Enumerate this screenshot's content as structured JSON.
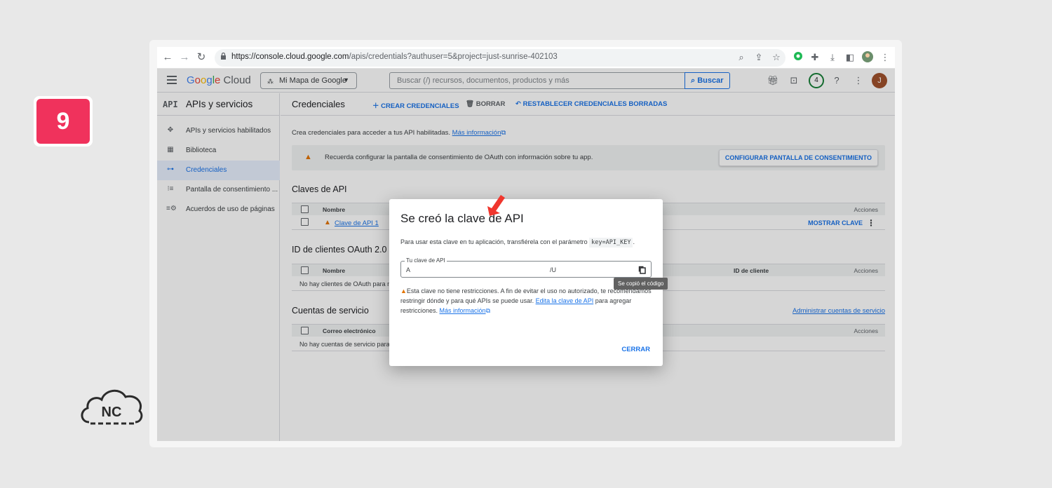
{
  "step": {
    "number": "9"
  },
  "brand": {
    "logo_text": "NC"
  },
  "browser": {
    "url_host": "https://console.cloud.google.com",
    "url_path": "/apis/credentials?authuser=5&project=just-sunrise-402103"
  },
  "header": {
    "logo": {
      "g1": "G",
      "g2": "o",
      "g3": "o",
      "g4": "g",
      "g5": "l",
      "g6": "e",
      "cloud": " Cloud"
    },
    "project": "Mi Mapa de Google",
    "search_placeholder": "Buscar (/) recursos, documentos, productos y más",
    "search_button": "Buscar",
    "notifications": "4",
    "avatar": "J"
  },
  "sidebar": {
    "badge": "API",
    "title": "APIs y servicios",
    "items": [
      {
        "icon": "✥",
        "label": "APIs y servicios habilitados"
      },
      {
        "icon": "▦",
        "label": "Biblioteca"
      },
      {
        "icon": "⊶",
        "label": "Credenciales"
      },
      {
        "icon": "⁝≡",
        "label": "Pantalla de consentimiento ..."
      },
      {
        "icon": "≡⚙",
        "label": "Acuerdos de uso de páginas"
      }
    ]
  },
  "toolbar": {
    "title": "Credenciales",
    "create": "CREAR CREDENCIALES",
    "delete": "BORRAR",
    "restore": "RESTABLECER CREDENCIALES BORRADAS"
  },
  "main": {
    "description": "Crea credenciales para acceder a tus API habilitadas.",
    "more_info": "Más información",
    "oauth_warning": "Recuerda configurar la pantalla de consentimiento de OAuth con información sobre tu app.",
    "configure_button": "CONFIGURAR PANTALLA DE CONSENTIMIENTO",
    "api_keys": {
      "title": "Claves de API",
      "col_name": "Nombre",
      "col_actions": "Acciones",
      "row_name": "Clave de API 1",
      "show_key": "MOSTRAR CLAVE"
    },
    "oauth_clients": {
      "title": "ID de clientes OAuth 2.0",
      "col_name": "Nombre",
      "col_client_id": "ID de cliente",
      "col_actions": "Acciones",
      "empty": "No hay clientes de OAuth para m"
    },
    "service_accounts": {
      "title": "Cuentas de servicio",
      "manage": "Administrar cuentas de servicio",
      "col_email": "Correo electrónico",
      "col_actions": "Acciones",
      "empty": "No hay cuentas de servicio para"
    }
  },
  "dialog": {
    "title": "Se creó la clave de API",
    "body": "Para usar esta clave en tu aplicación, transfiérela con el parámetro",
    "param": "key=API_KEY",
    "field_label": "Tu clave de API",
    "field_value_start": "A",
    "field_value_end": "/U",
    "tooltip": "Se copió el código",
    "warning_1": "Esta clave no tiene restricciones. A fin de evitar el uso no autorizado, te recomendamos restringir dónde y para qué APIs se puede usar.",
    "edit_link": "Edita la clave de API",
    "warning_2": "para agregar restricciones.",
    "more_info": "Más información",
    "close": "CERRAR"
  }
}
